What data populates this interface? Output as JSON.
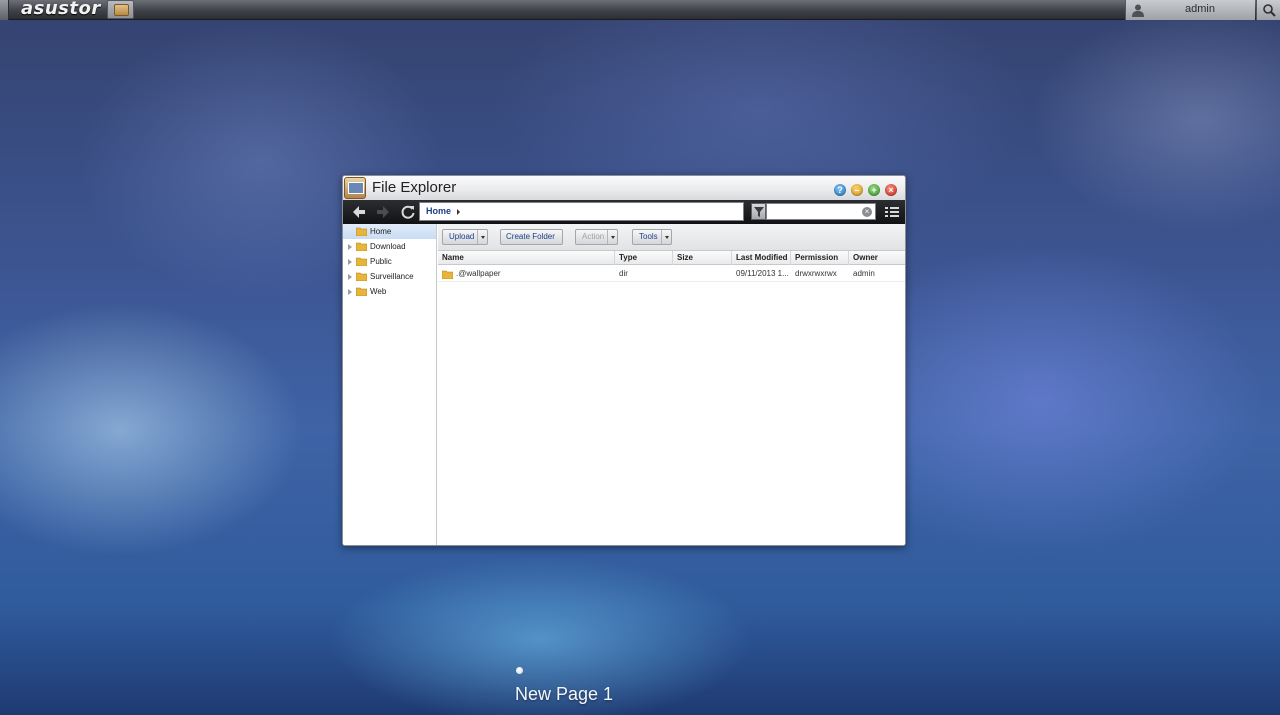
{
  "topbar": {
    "logo": "asustor",
    "user_name": "admin",
    "icons": [
      "app-launcher-icon",
      "user-icon",
      "search-icon"
    ]
  },
  "window": {
    "title": "File Explorer",
    "controls": [
      "help-icon",
      "minimize-icon",
      "maximize-icon",
      "close-icon"
    ],
    "controls_text": {
      "help": "?",
      "minimize": "–",
      "maximize": "+",
      "close": "×"
    },
    "nav": {
      "path": "Home",
      "icons": [
        "back-arrow-icon",
        "forward-arrow-icon",
        "refresh-icon",
        "filter-icon",
        "list-view-icon"
      ]
    },
    "sidebar": {
      "items": [
        {
          "label": "Home",
          "selected": true
        },
        {
          "label": "Download",
          "selected": false
        },
        {
          "label": "Public",
          "selected": false
        },
        {
          "label": "Surveillance",
          "selected": false
        },
        {
          "label": "Web",
          "selected": false
        }
      ]
    },
    "toolbar": {
      "upload": "Upload",
      "create_folder": "Create Folder",
      "action": "Action",
      "tools": "Tools"
    },
    "table": {
      "columns": [
        "Name",
        "Type",
        "Size",
        "Last Modified",
        "Permission",
        "Owner"
      ],
      "rows": [
        {
          "name": ".@wallpaper",
          "type": "dir",
          "size": "",
          "modified": "09/11/2013 1...",
          "permission": "drwxrwxrwx",
          "owner": "admin"
        }
      ]
    }
  },
  "desktop": {
    "page_label": "New Page 1"
  },
  "colors": {
    "accent": "#1e3f87",
    "titlebar": "#e9eaec",
    "navbar": "#1b1c1f"
  }
}
